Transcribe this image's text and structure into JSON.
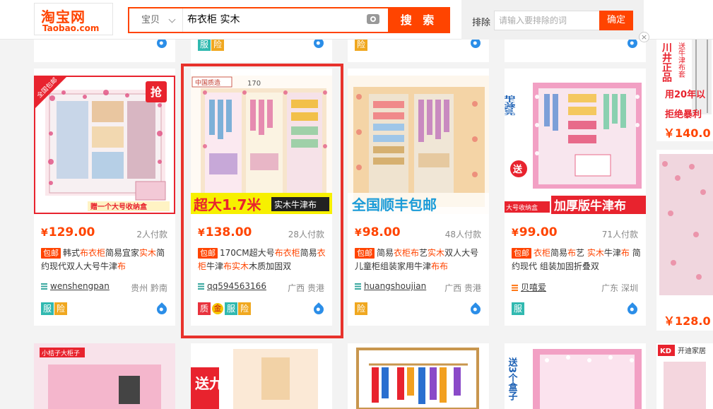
{
  "header": {
    "logo_cn": "淘宝网",
    "logo_en": "Taobao.com",
    "search_category": "宝贝",
    "search_query": "布衣柜 实木",
    "search_button": "搜 索",
    "exclude_label": "排除",
    "exclude_placeholder": "请输入要排除的词",
    "exclude_button": "确定"
  },
  "top_row": [
    {
      "badges": [
        "fu"
      ]
    },
    {
      "badges": [
        "fu",
        "xian"
      ]
    },
    {
      "badges": [
        "xian"
      ]
    },
    {
      "badges": []
    }
  ],
  "products": [
    {
      "price": "129.00",
      "sales": "2人付款",
      "tag": "包邮",
      "title_parts": [
        [
          "韩式",
          false
        ],
        [
          "布衣柜",
          true
        ],
        [
          "简易宜家",
          false
        ],
        [
          "实木",
          true
        ],
        [
          "简约现代双人大号牛津",
          false
        ],
        [
          "布",
          true
        ]
      ],
      "shop": "wenshengpan",
      "location": "贵州 黔南",
      "badges": [
        "服",
        "险"
      ],
      "image_text_1": "全国包邮",
      "image_text_2": "抢",
      "image_text_3": "赠一个大号收纳盒"
    },
    {
      "price": "138.00",
      "sales": "28人付款",
      "tag": "包邮",
      "title_parts": [
        [
          "170CM超大号",
          false
        ],
        [
          "布衣柜",
          true
        ],
        [
          "简易",
          false
        ],
        [
          "衣柜",
          true
        ],
        [
          "牛津",
          false
        ],
        [
          "布",
          true
        ],
        [
          "实木",
          true
        ],
        [
          "木质加固双",
          false
        ]
      ],
      "shop": "qq594563166",
      "location": "广西 贵港",
      "badges": [
        "质",
        "金",
        "服",
        "险"
      ],
      "image_text_1": "中国质造",
      "image_text_2": "170",
      "image_text_3": "超大1.7米",
      "image_text_4": "实木牛津布"
    },
    {
      "price": "98.00",
      "sales": "48人付款",
      "tag": "包邮",
      "title_parts": [
        [
          "简易",
          false
        ],
        [
          "衣柜布",
          true
        ],
        [
          "艺",
          false
        ],
        [
          "实木",
          true
        ],
        [
          "双人大号儿童柜组装家用牛津",
          false
        ],
        [
          "布布",
          true
        ]
      ],
      "shop": "huangshoujian",
      "location": "广西 贵港",
      "badges": [
        "险"
      ],
      "image_text_1": "全国顺丰包邮"
    },
    {
      "price": "99.00",
      "sales": "71人付款",
      "tag": "包邮",
      "title_parts": [
        [
          "衣柜",
          true
        ],
        [
          "简易",
          false
        ],
        [
          "布",
          true
        ],
        [
          "艺 ",
          false
        ],
        [
          "实木",
          true
        ],
        [
          "牛津",
          false
        ],
        [
          "布",
          true
        ],
        [
          " 简约现代 组装加固折叠双",
          false
        ]
      ],
      "shop": "贝嘻爱",
      "location": "广东 深圳",
      "badges": [
        "服"
      ],
      "image_text_1": "拍下立减20元",
      "image_text_2": "送",
      "image_text_3": "大号收纳盒",
      "image_text_4": "加厚版牛津布"
    }
  ],
  "right_col": {
    "ad_text_1": "川井正品",
    "ad_text_2": "送牛津布套",
    "ad_text_3": "用20年以",
    "ad_text_4": "拒绝暴利",
    "price_1": "￥140.0",
    "price_2": "￥128.0"
  },
  "bottom_row": {
    "text_1": "小桔子大柜子",
    "text_2": "送九",
    "text_3": "送3个盒子",
    "text_4": "开迪家居",
    "logo_4": "KD"
  },
  "colors": {
    "accent": "#ff4400",
    "highlight": "#e8322c"
  }
}
